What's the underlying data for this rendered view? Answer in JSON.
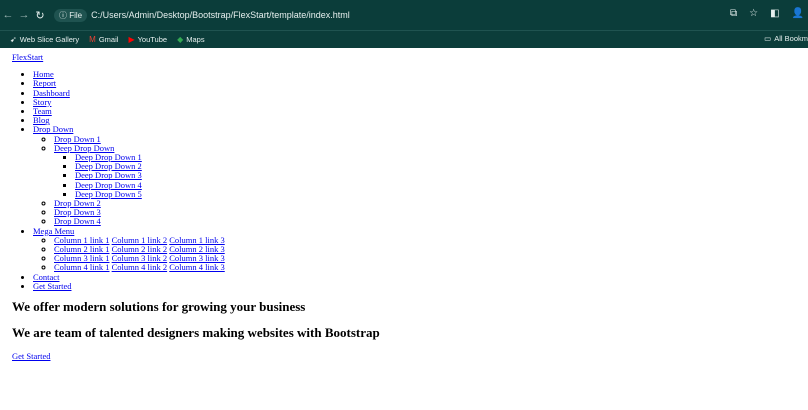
{
  "browser": {
    "file_badge": "File",
    "url": "C:/Users/Admin/Desktop/Bootstrap/FlexStart/template/index.html",
    "bookmarks": [
      {
        "label": "Web Slice Gallery",
        "icon": "web-slice-icon"
      },
      {
        "label": "Gmail",
        "icon": "gmail-icon"
      },
      {
        "label": "YouTube",
        "icon": "youtube-icon"
      },
      {
        "label": "Maps",
        "icon": "maps-icon"
      }
    ],
    "all_bookmarks": "All Bookm"
  },
  "brand": "FlexStart",
  "nav": {
    "home": "Home",
    "report": "Report",
    "dashboard": "Dashboard",
    "story": "Story",
    "team": "Team",
    "blog": "Blog",
    "dropdown": "Drop Down",
    "dropdown_items": {
      "d1": "Drop Down 1",
      "deep": "Deep Drop Down",
      "deep_items": [
        "Deep Drop Down 1",
        "Deep Drop Down 2",
        "Deep Drop Down 3",
        "Deep Drop Down 4",
        "Deep Drop Down 5"
      ],
      "d2": "Drop Down 2",
      "d3": "Drop Down 3",
      "d4": "Drop Down 4"
    },
    "mega": "Mega Menu",
    "mega_rows": [
      [
        "Column 1 link 1",
        "Column 1 link 2",
        "Column 1 link 3"
      ],
      [
        "Column 2 link 1",
        "Column 2 link 2",
        "Column 2 link 3"
      ],
      [
        "Column 3 link 1",
        "Column 3 link 2",
        "Column 3 link 3"
      ],
      [
        "Column 4 link 1",
        "Column 4 link 2",
        "Column 4 link 3"
      ]
    ],
    "contact": "Contact",
    "get_started": "Get Started"
  },
  "hero": {
    "title": "We offer modern solutions for growing your business",
    "subtitle": "We are team of talented designers making websites with Bootstrap",
    "cta": "Get Started"
  }
}
